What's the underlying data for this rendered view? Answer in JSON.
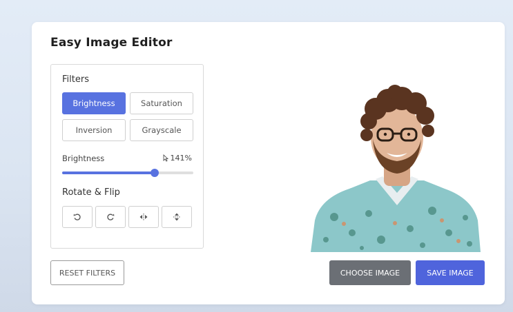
{
  "app": {
    "title": "Easy Image Editor"
  },
  "filters": {
    "heading": "Filters",
    "buttons": [
      {
        "label": "Brightness",
        "active": true
      },
      {
        "label": "Saturation",
        "active": false
      },
      {
        "label": "Inversion",
        "active": false
      },
      {
        "label": "Grayscale",
        "active": false
      }
    ]
  },
  "slider": {
    "label": "Brightness",
    "value_text": "141%",
    "value": 141,
    "max": 200
  },
  "rotate": {
    "heading": "Rotate & Flip",
    "buttons": [
      {
        "icon": "rotate-left-icon"
      },
      {
        "icon": "rotate-right-icon"
      },
      {
        "icon": "flip-horizontal-icon"
      },
      {
        "icon": "flip-vertical-icon"
      }
    ]
  },
  "actions": {
    "reset": "RESET FILTERS",
    "choose": "CHOOSE IMAGE",
    "save": "SAVE IMAGE"
  },
  "colors": {
    "accent": "#5872e0",
    "save": "#4f64dc",
    "choose": "#6b6f75"
  }
}
